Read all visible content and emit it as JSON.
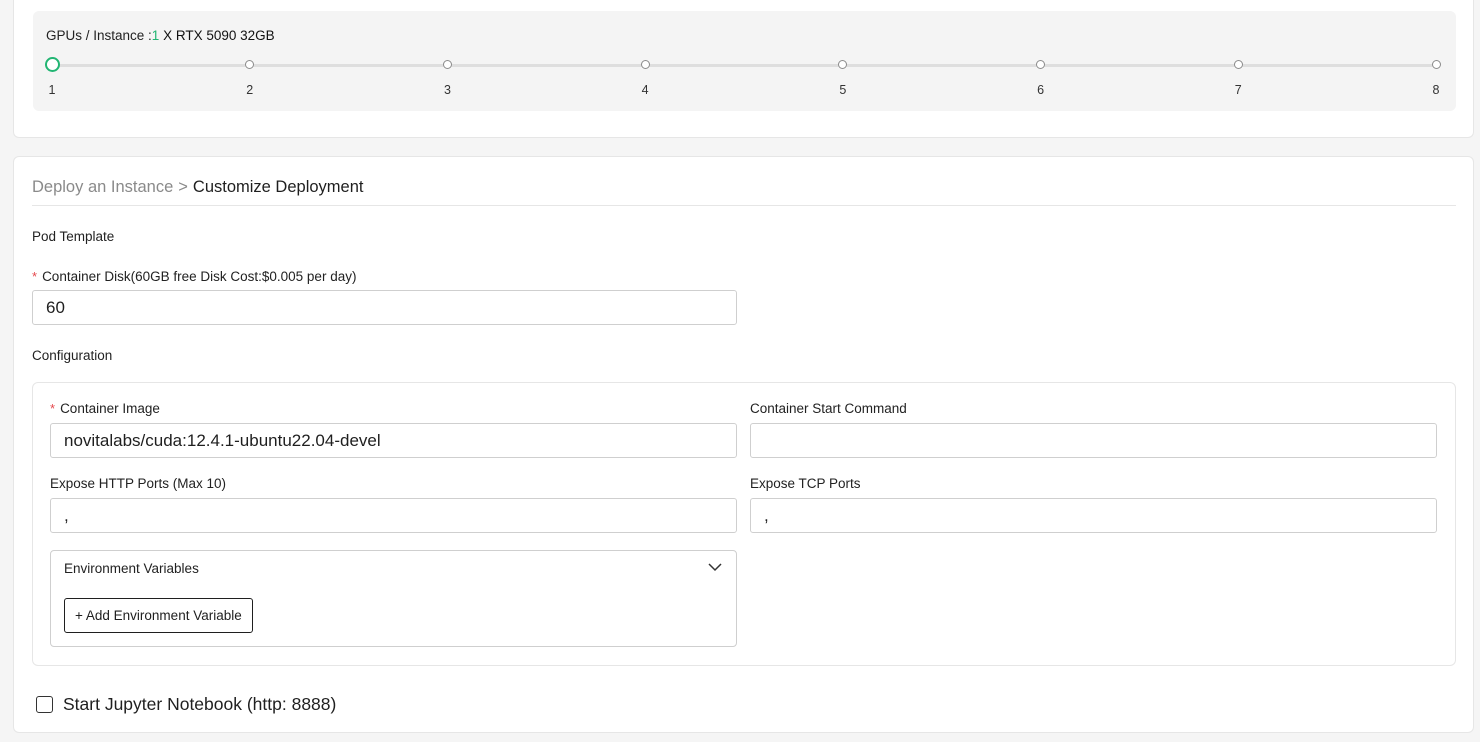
{
  "gpu": {
    "label": "GPUs / Instance :",
    "count": "1",
    "model": "X RTX 5090 32GB",
    "options": [
      "1",
      "2",
      "3",
      "4",
      "5",
      "6",
      "7",
      "8"
    ],
    "selected": 1
  },
  "breadcrumb": {
    "parent": "Deploy an Instance",
    "separator": ">",
    "current": "Customize Deployment"
  },
  "pod_template": {
    "label": "Pod Template"
  },
  "container_disk": {
    "required_mark": "*",
    "label": "Container Disk(60GB free Disk Cost:$0.005 per day)",
    "value": "60"
  },
  "configuration": {
    "label": "Configuration",
    "container_image": {
      "required_mark": "*",
      "label": "Container Image",
      "value": "novitalabs/cuda:12.4.1-ubuntu22.04-devel"
    },
    "start_command": {
      "label": "Container Start Command",
      "value": ""
    },
    "http_ports": {
      "label": "Expose HTTP Ports (Max 10)",
      "value": ","
    },
    "tcp_ports": {
      "label": "Expose TCP Ports",
      "value": ","
    },
    "env": {
      "title": "Environment Variables",
      "add_button": "+ Add Environment Variable"
    }
  },
  "jupyter": {
    "label": "Start Jupyter Notebook (http: 8888)",
    "checked": false
  },
  "colors": {
    "accent": "#22b573",
    "required": "#e5484d"
  }
}
